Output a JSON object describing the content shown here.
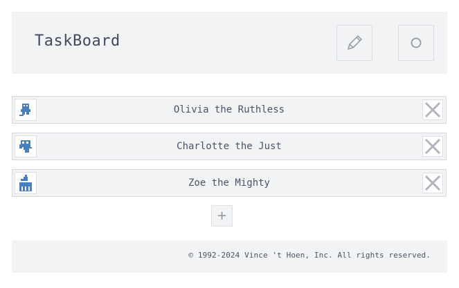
{
  "app": {
    "title": "TaskBoard"
  },
  "header": {
    "edit_icon": "pencil-icon",
    "settings_icon": "circle-icon"
  },
  "users": [
    {
      "name": "Olivia the Ruthless",
      "avatar_icon": "pixel-robot-avatar"
    },
    {
      "name": "Charlotte the Just",
      "avatar_icon": "pixel-monster-avatar"
    },
    {
      "name": "Zoe the Mighty",
      "avatar_icon": "pixel-castle-avatar"
    }
  ],
  "add_button": {
    "label": "+"
  },
  "footer": {
    "copyright": "© 1992-2024 Vince 't Hoen, Inc. All rights reserved."
  },
  "colors": {
    "accent": "#4a7fbf",
    "panel": "#f2f3f5",
    "text": "#4a5366"
  }
}
